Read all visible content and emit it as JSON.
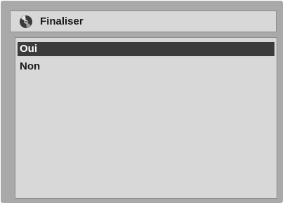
{
  "dialog": {
    "title": "Finaliser",
    "icon": "disc-icon"
  },
  "options": [
    {
      "label": "Oui",
      "selected": true
    },
    {
      "label": "Non",
      "selected": false
    }
  ],
  "colors": {
    "frame": "#a9a9a9",
    "panel": "#d8d8d8",
    "selection": "#3c3c3c"
  }
}
